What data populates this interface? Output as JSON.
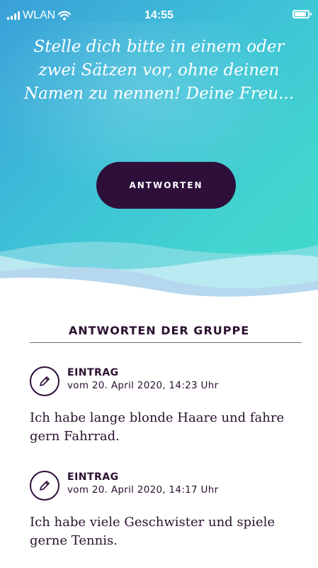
{
  "status_bar": {
    "carrier": "WLAN",
    "time": "14:55"
  },
  "prompt": {
    "lines": [
      "Stelle dich bitte in einem oder",
      "zwei Sätzen vor, ohne deinen",
      "Namen zu nennen! Deine Freu..."
    ]
  },
  "answer_button_label": "ANTWORTEN",
  "section_title": "ANTWORTEN DER GRUPPE",
  "entries": [
    {
      "label": "EINTRAG",
      "date": "vom 20. April 2020, 14:23 Uhr",
      "text": "Ich habe lange blonde Haare und fahre gern Fahrrad."
    },
    {
      "label": "EINTRAG",
      "date": "vom 20. April 2020, 14:17 Uhr",
      "text": "Ich habe viele Geschwister und spiele gerne Tennis."
    }
  ],
  "icons": {
    "signal": "signal-bars-icon",
    "wifi": "wifi-icon",
    "battery": "battery-icon",
    "entry": "pencil-icon"
  },
  "colors": {
    "primary": "#2e0f3a",
    "gradient_start": "#3aa0d8",
    "gradient_end": "#40d9cc",
    "text": "#2b1130"
  }
}
